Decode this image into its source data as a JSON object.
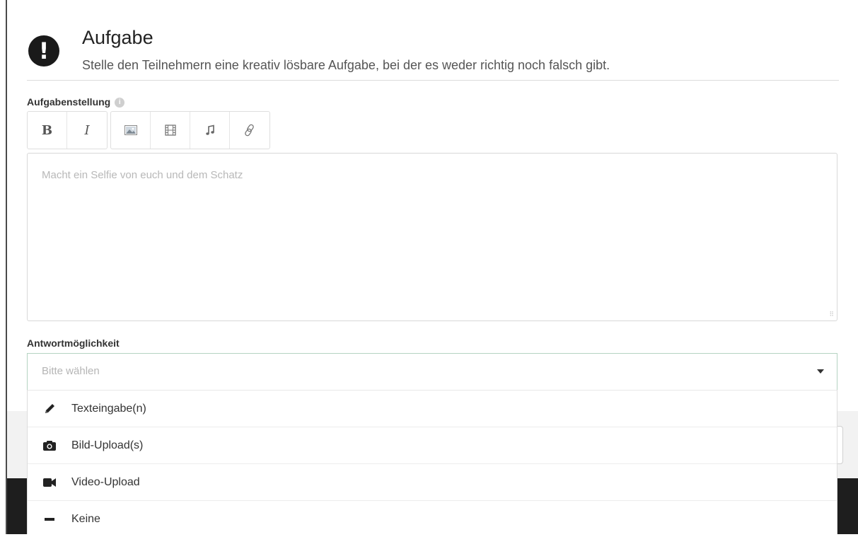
{
  "header": {
    "title": "Aufgabe",
    "subtitle": "Stelle den Teilnehmern eine kreativ lösbare Aufgabe, bei der es weder richtig noch falsch gibt.",
    "icon": "exclamation-icon"
  },
  "task_field": {
    "label": "Aufgabenstellung",
    "placeholder": "Macht ein Selfie von euch und dem Schatz",
    "toolbar": [
      {
        "name": "bold",
        "glyph": "B"
      },
      {
        "name": "italic",
        "glyph": "I"
      },
      {
        "name": "image",
        "icon": "image-icon"
      },
      {
        "name": "video",
        "icon": "film-icon"
      },
      {
        "name": "audio",
        "icon": "music-icon"
      },
      {
        "name": "link",
        "icon": "link-icon"
      }
    ]
  },
  "answer_field": {
    "label": "Antwortmöglichkeit",
    "placeholder": "Bitte wählen",
    "options": [
      {
        "label": "Texteingabe(n)",
        "icon": "pencil-icon"
      },
      {
        "label": "Bild-Upload(s)",
        "icon": "camera-icon"
      },
      {
        "label": "Video-Upload",
        "icon": "video-camera-icon"
      },
      {
        "label": "Keine",
        "icon": "minus-icon"
      }
    ]
  },
  "colors": {
    "accent_border": "#b5d3c2",
    "footer_bg": "#1e1e1e"
  }
}
